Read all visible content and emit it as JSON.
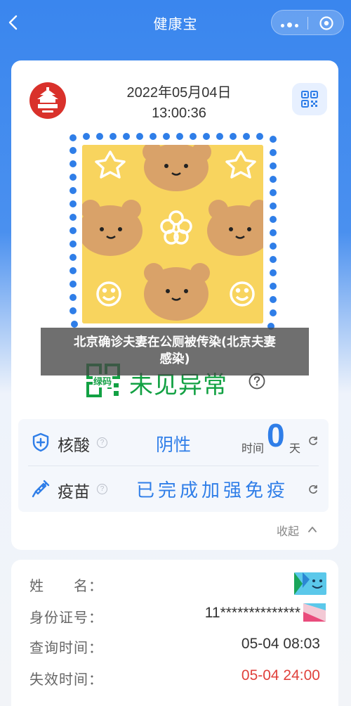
{
  "header": {
    "title": "健康宝",
    "back_icon": "chevron-left-icon",
    "more_icon": "ellipsis-icon",
    "close_icon": "target-circle-icon"
  },
  "card": {
    "date": "2022年05月04日",
    "time": "13:00:36",
    "seal_icon": "beijing-tiananmen-seal-icon",
    "qr_icon": "qr-code-icon"
  },
  "overlay": {
    "caption_line1": "北京确诊夫妻在公厕被传染(北京夫妻",
    "caption_line2": "感染)"
  },
  "status": {
    "code_label": "绿码",
    "status_text": "未见异常",
    "color": "#12a143"
  },
  "tests": {
    "nucleic": {
      "label": "核酸",
      "result": "阴性",
      "time_label": "时间",
      "days": "0",
      "days_unit": "天"
    },
    "vaccine": {
      "label": "疫苗",
      "result": "已完成加强免疫"
    },
    "mini_help": "?",
    "collapse_label": "收起"
  },
  "info": {
    "name_label": "姓　　名：",
    "id_label": "身份证号：",
    "id_value": "11**************",
    "query_label": "查询时间：",
    "query_value": "05-04 08:03",
    "expire_label": "失效时间：",
    "expire_value": "05-04 24:00"
  },
  "colors": {
    "accent_blue": "#2f7ee8",
    "header_blue": "#3a86ee",
    "green": "#12a143",
    "red": "#e0413c",
    "code_bg": "#f8d45e"
  }
}
